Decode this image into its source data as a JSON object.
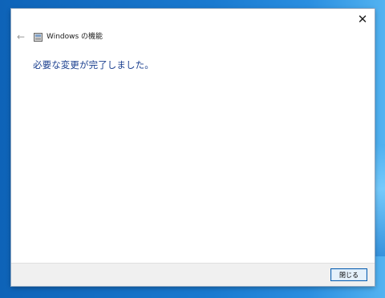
{
  "window": {
    "title": "Windows の機能",
    "close_glyph": "✕",
    "back_glyph": "←"
  },
  "content": {
    "message": "必要な変更が完了しました。"
  },
  "footer": {
    "close_button_label": "閉じる"
  },
  "colors": {
    "accent_text": "#1a3f8f",
    "desktop": "#1572c4",
    "button_border": "#0a5fb0"
  },
  "icons": {
    "back": "arrow-left-icon",
    "app": "windows-features-icon",
    "close": "close-icon"
  }
}
